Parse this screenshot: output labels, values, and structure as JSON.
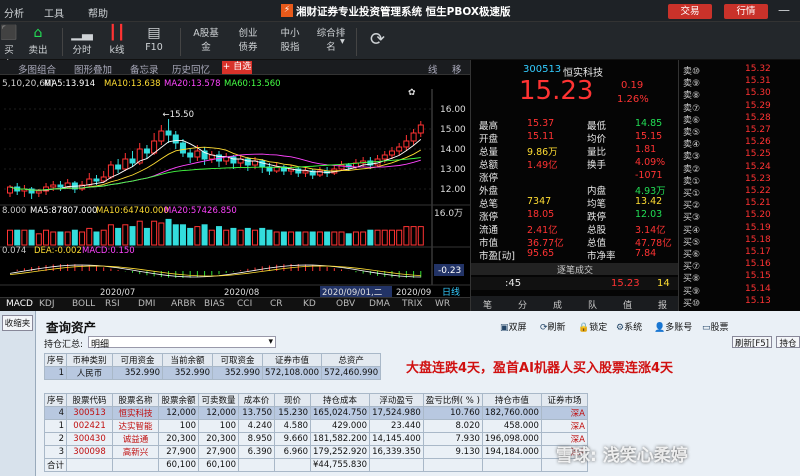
{
  "titlebar": {
    "menu": [
      "分析",
      "工具",
      "帮助"
    ],
    "title": "湘财证券专业投资管理系统 恒生PBOX极速版",
    "buttons": [
      "交易",
      "行情"
    ]
  },
  "toolbar": {
    "items": [
      "买入",
      "卖出",
      "分时",
      "k线",
      "F10",
      "A股基金",
      "创业债券",
      "中小股指",
      "综合排名"
    ]
  },
  "chart_tabs": [
    "多图组合",
    "图形叠加",
    "备忘录",
    "历史回忆"
  ],
  "chart_tabs_extra": "自选",
  "chart_side": [
    "线",
    "移"
  ],
  "chart_data": {
    "type": "candlestick",
    "ma_legend": "5,10,20,60)",
    "ma": [
      {
        "label": "MA5:13.914",
        "color": "#ffffff"
      },
      {
        "label": "MA10:13.638",
        "color": "#ffdd33"
      },
      {
        "label": "MA20:13.578",
        "color": "#ff44ff"
      },
      {
        "label": "MA60:13.560",
        "color": "#44ff44"
      }
    ],
    "high_label": "15.50",
    "y_ticks": [
      "16.00",
      "15.00",
      "14.00",
      "13.00",
      "12.00"
    ],
    "candles": [
      [
        11.8,
        12.1,
        11.6,
        12.2
      ],
      [
        12.1,
        11.9,
        11.7,
        12.3
      ],
      [
        11.9,
        12.0,
        11.6,
        12.2
      ],
      [
        12.0,
        11.8,
        11.5,
        12.1
      ],
      [
        11.8,
        11.9,
        11.6,
        12.0
      ],
      [
        11.9,
        12.1,
        11.7,
        12.3
      ],
      [
        12.1,
        12.2,
        11.9,
        12.4
      ],
      [
        12.2,
        12.1,
        11.9,
        12.4
      ],
      [
        12.1,
        12.3,
        12.0,
        12.5
      ],
      [
        12.3,
        12.0,
        11.8,
        12.4
      ],
      [
        12.0,
        12.2,
        11.9,
        12.4
      ],
      [
        12.2,
        12.5,
        12.1,
        12.8
      ],
      [
        12.5,
        12.4,
        12.2,
        12.7
      ],
      [
        12.4,
        12.6,
        12.3,
        12.9
      ],
      [
        12.6,
        13.2,
        12.5,
        13.4
      ],
      [
        13.2,
        13.0,
        12.8,
        13.5
      ],
      [
        13.0,
        13.5,
        12.9,
        13.8
      ],
      [
        13.5,
        13.3,
        13.1,
        13.9
      ],
      [
        13.3,
        14.0,
        13.2,
        14.3
      ],
      [
        14.0,
        13.8,
        13.5,
        14.2
      ],
      [
        13.8,
        14.4,
        13.7,
        14.8
      ],
      [
        14.4,
        14.9,
        14.2,
        15.2
      ],
      [
        14.9,
        14.7,
        14.3,
        15.5
      ],
      [
        14.7,
        14.3,
        14.0,
        14.9
      ],
      [
        14.3,
        13.8,
        13.6,
        14.5
      ],
      [
        13.8,
        13.6,
        13.3,
        14.0
      ],
      [
        13.6,
        13.9,
        13.4,
        14.2
      ],
      [
        13.9,
        13.5,
        13.2,
        14.1
      ],
      [
        13.5,
        13.7,
        13.3,
        13.9
      ],
      [
        13.7,
        13.4,
        13.1,
        13.9
      ],
      [
        13.4,
        13.6,
        13.2,
        13.8
      ],
      [
        13.6,
        13.3,
        13.0,
        13.7
      ],
      [
        13.3,
        13.5,
        13.1,
        13.7
      ],
      [
        13.5,
        13.2,
        12.9,
        13.6
      ],
      [
        13.2,
        13.4,
        13.0,
        13.6
      ],
      [
        13.4,
        13.1,
        12.8,
        13.5
      ],
      [
        13.1,
        12.9,
        12.7,
        13.3
      ],
      [
        12.9,
        13.1,
        12.8,
        13.3
      ],
      [
        13.1,
        12.9,
        12.7,
        13.2
      ],
      [
        12.9,
        13.0,
        12.7,
        13.2
      ],
      [
        13.0,
        12.8,
        12.6,
        13.1
      ],
      [
        12.8,
        12.9,
        12.6,
        13.1
      ],
      [
        12.9,
        12.7,
        12.5,
        13.0
      ],
      [
        12.7,
        12.9,
        12.6,
        13.1
      ],
      [
        12.9,
        12.8,
        12.6,
        13.1
      ],
      [
        12.8,
        13.0,
        12.7,
        13.2
      ],
      [
        13.0,
        13.2,
        12.9,
        13.4
      ],
      [
        13.2,
        13.1,
        12.9,
        13.3
      ],
      [
        13.1,
        13.3,
        13.0,
        13.5
      ],
      [
        13.3,
        13.4,
        13.1,
        13.6
      ],
      [
        13.4,
        13.2,
        13.0,
        13.6
      ],
      [
        13.2,
        13.5,
        13.1,
        13.7
      ],
      [
        13.5,
        13.7,
        13.3,
        13.9
      ],
      [
        13.7,
        13.9,
        13.5,
        14.1
      ],
      [
        13.9,
        14.1,
        13.7,
        14.3
      ],
      [
        14.1,
        14.4,
        13.9,
        14.7
      ],
      [
        14.4,
        14.8,
        14.2,
        15.0
      ],
      [
        14.8,
        15.2,
        14.6,
        15.4
      ]
    ],
    "vol_legend": [
      "8.000",
      "MA5:87807.000",
      "MA10:64740.000",
      "MA20:57426.850"
    ],
    "vol_ticks": [
      "16.0万"
    ],
    "macd_legend": [
      "0.074",
      "DEA:-0.002",
      "MACD:0.150"
    ],
    "macd_tick": "-0.23",
    "x_ticks": [
      "2020/07",
      "2020/08",
      "2020/09/01,二",
      "2020/09"
    ],
    "x_extra": "日线"
  },
  "indicators": [
    "MACD",
    "KDJ",
    "BOLL",
    "RSI",
    "DMI",
    "ARBR",
    "BIAS",
    "CCI",
    "CR",
    "KD",
    "OBV",
    "DMA",
    "TRIX",
    "WR"
  ],
  "quote": {
    "code": "300513",
    "name": "恒实科技",
    "price": "15.23",
    "change": "0.19",
    "pct": "1.26%",
    "rows": [
      [
        "最高",
        "15.37",
        "最低",
        "14.85"
      ],
      [
        "开盘",
        "15.11",
        "均价",
        "15.15"
      ],
      [
        "总量",
        "9.86万",
        "量比",
        "1.81"
      ],
      [
        "总额",
        "1.49亿",
        "换手",
        "4.09%"
      ],
      [
        "涨停",
        "",
        "",
        "-1071"
      ],
      [
        "外盘",
        "",
        "内盘",
        "4.93万"
      ],
      [
        "总笔",
        "7347",
        "均笔",
        "13.42"
      ],
      [
        "涨停",
        "18.05",
        "跌停",
        "12.03"
      ],
      [
        "流通",
        "2.41亿",
        "总股",
        "3.14亿"
      ],
      [
        "市值",
        "36.77亿",
        "总值",
        "47.78亿"
      ],
      [
        "市盈[动]",
        "95.65",
        "市净率",
        "7.84"
      ]
    ],
    "deal_header": "逐笔成交",
    "deal_row": [
      ":45",
      "15.23",
      "14"
    ],
    "tabs": [
      "笔",
      "分",
      "成",
      "队",
      "值",
      "报"
    ]
  },
  "book": [
    [
      "卖⑩",
      "15.32"
    ],
    [
      "卖⑨",
      "15.31"
    ],
    [
      "卖⑧",
      "15.30"
    ],
    [
      "卖⑦",
      "15.29"
    ],
    [
      "卖⑥",
      "15.28"
    ],
    [
      "卖⑤",
      "15.27"
    ],
    [
      "卖④",
      "15.26"
    ],
    [
      "卖③",
      "15.25"
    ],
    [
      "卖②",
      "15.24"
    ],
    [
      "卖①",
      "15.23"
    ],
    [
      "买①",
      "15.22"
    ],
    [
      "买②",
      "15.21"
    ],
    [
      "买③",
      "15.20"
    ],
    [
      "买④",
      "15.19"
    ],
    [
      "买⑤",
      "15.18"
    ],
    [
      "买⑥",
      "15.17"
    ],
    [
      "买⑦",
      "15.16"
    ],
    [
      "买⑧",
      "15.15"
    ],
    [
      "买⑨",
      "15.14"
    ],
    [
      "买⑩",
      "15.13"
    ]
  ],
  "panel": {
    "left_btn": "收缩夹",
    "title": "查询资产",
    "actions": [
      "双屏",
      "刷新",
      "锁定",
      "系统",
      "多账号",
      "股票"
    ],
    "summary_label": "持仓汇总:",
    "summary_value": "明细",
    "refresh_btn": "刷新[F5]",
    "stock_btn": "持仓",
    "headline": "大盘连跌4天，盈首AI机器人买入股票连涨4天",
    "asset_headers": [
      "序号",
      "币种类别",
      "可用资金",
      "当前余额",
      "可取资金",
      "证券市值",
      "总资产"
    ],
    "asset_rows": [
      [
        "1",
        "人民币",
        "352.990",
        "352.990",
        "352.990",
        "572,108.000",
        "572,460.990"
      ]
    ],
    "pos_headers": [
      "序号",
      "股票代码",
      "股票名称",
      "股票余额",
      "可卖数量",
      "成本价",
      "现价",
      "持仓成本",
      "浮动盈亏",
      "盈亏比例( % )",
      "持仓市值",
      "证券市场"
    ],
    "pos_rows": [
      [
        "4",
        "300513",
        "恒实科技",
        "12,000",
        "12,000",
        "13.750",
        "15.230",
        "165,024.750",
        "17,524.980",
        "10.760",
        "182,760.000",
        "深A"
      ],
      [
        "1",
        "002421",
        "达实智能",
        "100",
        "100",
        "4.240",
        "4.580",
        "429.000",
        "23.440",
        "8.020",
        "458.000",
        "深A"
      ],
      [
        "2",
        "300430",
        "诚益通",
        "20,300",
        "20,300",
        "8.950",
        "9.660",
        "181,582.200",
        "14,145.400",
        "7.930",
        "196,098.000",
        "深A"
      ],
      [
        "3",
        "300098",
        "高新兴",
        "27,900",
        "27,900",
        "6.390",
        "6.960",
        "179,252.920",
        "16,339.350",
        "9.130",
        "194,184.000",
        "深A"
      ]
    ],
    "total_label": "合计",
    "total_qty": "60,100",
    "total_sell": "60,100",
    "total_pl": "¥44,755.830",
    "watermark": "雪球: 浅笑心柔婷"
  }
}
